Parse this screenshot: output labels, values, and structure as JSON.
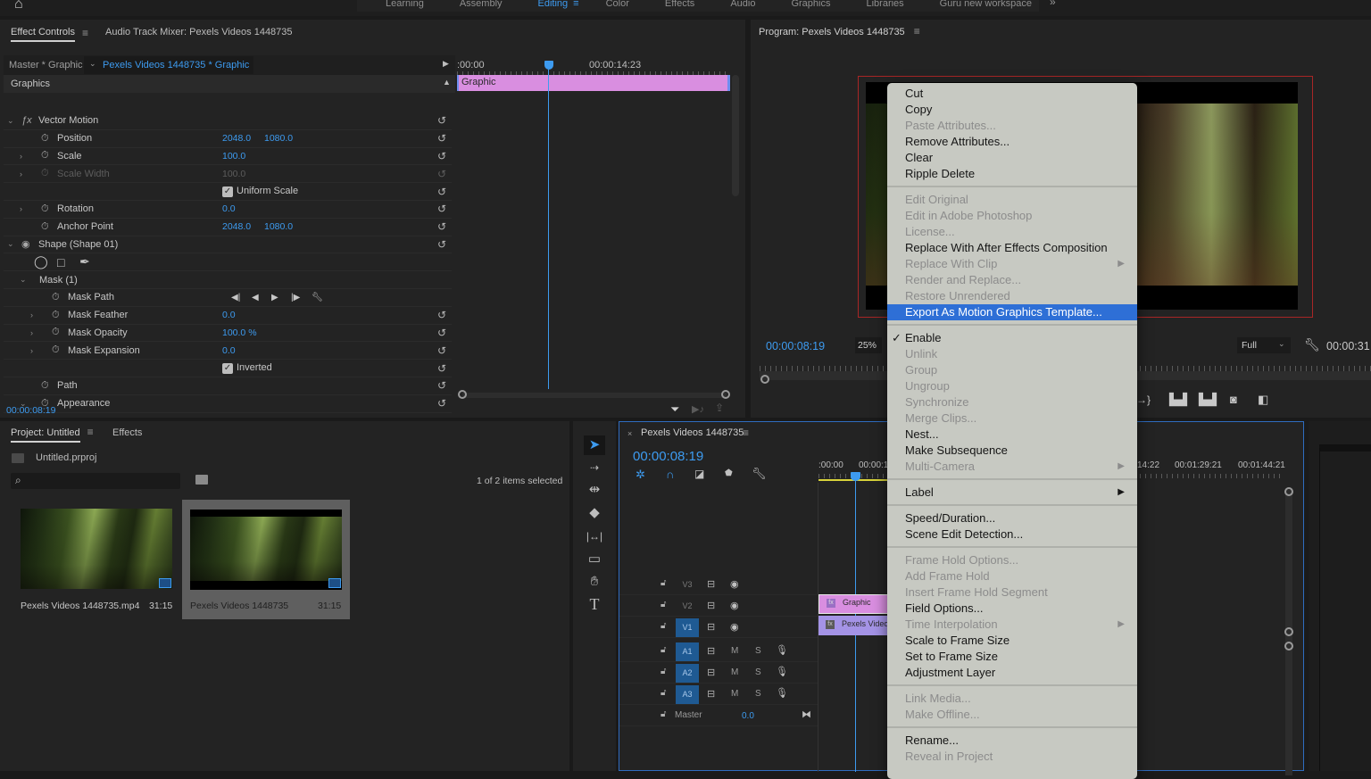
{
  "workspace": {
    "tabs": [
      "Learning",
      "Assembly",
      "Editing",
      "Color",
      "Effects",
      "Audio",
      "Graphics",
      "Libraries",
      "Guru new workspace"
    ],
    "active_tab": "Editing",
    "more_label": "»"
  },
  "effect_controls": {
    "tab_effect_controls": "Effect Controls",
    "tab_audio_mixer": "Audio Track Mixer: Pexels Videos 1448735",
    "master_label": "Master * Graphic",
    "clip_label": "Pexels Videos 1448735 * Graphic",
    "section_label": "Graphics",
    "rows": [
      {
        "label": "Vector Motion",
        "type": "fx-header"
      },
      {
        "label": "Position",
        "v1": "2048.0",
        "v2": "1080.0"
      },
      {
        "label": "Scale",
        "v1": "100.0"
      },
      {
        "label": "Scale Width",
        "v1": "100.0",
        "disabled": true
      },
      {
        "label": "Uniform Scale",
        "type": "checkbox",
        "checked": true
      },
      {
        "label": "Rotation",
        "v1": "0.0"
      },
      {
        "label": "Anchor Point",
        "v1": "2048.0",
        "v2": "1080.0"
      },
      {
        "label": "Shape (Shape 01)",
        "type": "shape-header"
      },
      {
        "label": "",
        "type": "shape-tools"
      },
      {
        "label": "Mask (1)",
        "type": "mask-header"
      },
      {
        "label": "Mask Path",
        "type": "mask-path"
      },
      {
        "label": "Mask Feather",
        "v1": "0.0"
      },
      {
        "label": "Mask Opacity",
        "v1": "100.0 %"
      },
      {
        "label": "Mask Expansion",
        "v1": "0.0"
      },
      {
        "label": "Inverted",
        "type": "checkbox",
        "checked": true
      },
      {
        "label": "Path"
      },
      {
        "label": "Appearance"
      }
    ],
    "timeline_start": ":00:00",
    "timeline_mark": "00:00:14:23",
    "clip_bar_label": "Graphic",
    "current_time": "00:00:08:19"
  },
  "program_monitor": {
    "title": "Program: Pexels Videos 1448735",
    "current_time": "00:00:08:19",
    "zoom": "25%",
    "quality": "Full",
    "duration": "00:00:31"
  },
  "context_menu": {
    "groups": [
      [
        {
          "label": "Cut"
        },
        {
          "label": "Copy"
        },
        {
          "label": "Paste Attributes...",
          "disabled": true
        },
        {
          "label": "Remove Attributes..."
        },
        {
          "label": "Clear"
        },
        {
          "label": "Ripple Delete"
        }
      ],
      [
        {
          "label": "Edit Original",
          "disabled": true
        },
        {
          "label": "Edit in Adobe Photoshop",
          "disabled": true
        },
        {
          "label": "License...",
          "disabled": true
        },
        {
          "label": "Replace With After Effects Composition"
        },
        {
          "label": "Replace With Clip",
          "disabled": true,
          "submenu": true
        },
        {
          "label": "Render and Replace...",
          "disabled": true
        },
        {
          "label": "Restore Unrendered",
          "disabled": true
        },
        {
          "label": "Export As Motion Graphics Template...",
          "highlighted": true
        }
      ],
      [
        {
          "label": "Enable",
          "checked": true
        },
        {
          "label": "Unlink",
          "disabled": true
        },
        {
          "label": "Group",
          "disabled": true
        },
        {
          "label": "Ungroup",
          "disabled": true
        },
        {
          "label": "Synchronize",
          "disabled": true
        },
        {
          "label": "Merge Clips...",
          "disabled": true
        },
        {
          "label": "Nest..."
        },
        {
          "label": "Make Subsequence"
        },
        {
          "label": "Multi-Camera",
          "disabled": true,
          "submenu": true
        }
      ],
      [
        {
          "label": "Label",
          "submenu": true
        }
      ],
      [
        {
          "label": "Speed/Duration..."
        },
        {
          "label": "Scene Edit Detection..."
        }
      ],
      [
        {
          "label": "Frame Hold Options...",
          "disabled": true
        },
        {
          "label": "Add Frame Hold",
          "disabled": true
        },
        {
          "label": "Insert Frame Hold Segment",
          "disabled": true
        },
        {
          "label": "Field Options..."
        },
        {
          "label": "Time Interpolation",
          "disabled": true,
          "submenu": true
        },
        {
          "label": "Scale to Frame Size"
        },
        {
          "label": "Set to Frame Size"
        },
        {
          "label": "Adjustment Layer"
        }
      ],
      [
        {
          "label": "Link Media...",
          "disabled": true
        },
        {
          "label": "Make Offline...",
          "disabled": true
        }
      ],
      [
        {
          "label": "Rename..."
        },
        {
          "label": "Reveal in Project",
          "disabled": true
        }
      ]
    ]
  },
  "project": {
    "tab_project": "Project: Untitled",
    "tab_effects": "Effects",
    "file_name": "Untitled.prproj",
    "search_placeholder": "",
    "selection_status": "1 of 2 items selected",
    "items": [
      {
        "name": "Pexels Videos 1448735.mp4",
        "duration": "31:15",
        "selected": false
      },
      {
        "name": "Pexels Videos 1448735",
        "duration": "31:15",
        "selected": true
      }
    ]
  },
  "timeline": {
    "sequence_name": "Pexels Videos 1448735",
    "current_time": "00:00:08:19",
    "ruler_labels": [
      ":00:00",
      "00:00:1",
      "14:22",
      "00:01:29:21",
      "00:01:44:21"
    ],
    "video_tracks": [
      {
        "name": "V3",
        "targeted": false
      },
      {
        "name": "V2",
        "targeted": false
      },
      {
        "name": "V1",
        "targeted": true
      }
    ],
    "audio_tracks": [
      {
        "name": "A1",
        "mute": "M",
        "solo": "S"
      },
      {
        "name": "A2",
        "mute": "M",
        "solo": "S"
      },
      {
        "name": "A3",
        "mute": "M",
        "solo": "S"
      }
    ],
    "master_label": "Master",
    "master_value": "0.0",
    "clips": [
      {
        "track": "V2",
        "label": "Graphic",
        "color": "#d98ee0"
      },
      {
        "track": "V1",
        "label": "Pexels Videos",
        "color": "#a493e6"
      }
    ]
  }
}
